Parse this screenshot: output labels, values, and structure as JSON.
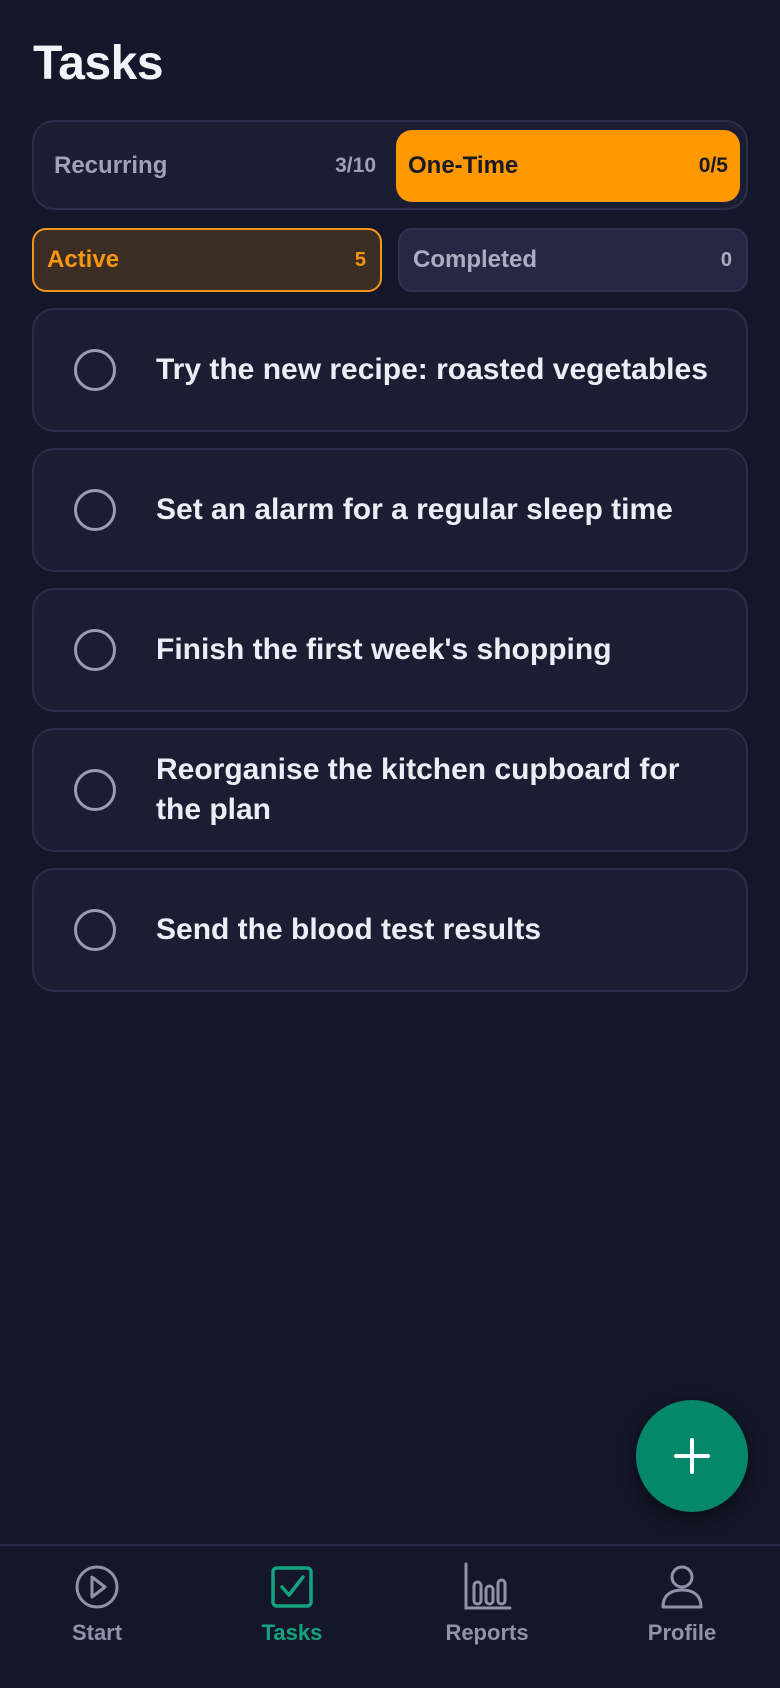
{
  "header": {
    "title": "Tasks"
  },
  "segments": [
    {
      "label": "Recurring",
      "count": "3/10",
      "selected": false
    },
    {
      "label": "One-Time",
      "count": "0/5",
      "selected": true
    }
  ],
  "filters": [
    {
      "label": "Active",
      "count": "5",
      "selected": true
    },
    {
      "label": "Completed",
      "count": "0",
      "selected": false
    }
  ],
  "tasks": [
    {
      "text": "Try the new recipe: roasted vegetables",
      "done": false
    },
    {
      "text": "Set an alarm for a regular sleep time",
      "done": false
    },
    {
      "text": "Finish the first week's shopping",
      "done": false
    },
    {
      "text": "Reorganise the kitchen cupboard for the plan",
      "done": false
    },
    {
      "text": "Send the blood test results",
      "done": false
    }
  ],
  "fab": {
    "icon": "plus-icon"
  },
  "nav": {
    "items": [
      {
        "label": "Start",
        "icon": "play-circle-icon",
        "active": false
      },
      {
        "label": "Tasks",
        "icon": "checkbox-icon",
        "active": true
      },
      {
        "label": "Reports",
        "icon": "bar-chart-icon",
        "active": false
      },
      {
        "label": "Profile",
        "icon": "person-icon",
        "active": false
      }
    ]
  },
  "colors": {
    "background": "#141629",
    "card": "#1b1e33",
    "accent_orange": "#fe9800",
    "accent_green": "#05876a",
    "nav_active": "#13a47f"
  }
}
